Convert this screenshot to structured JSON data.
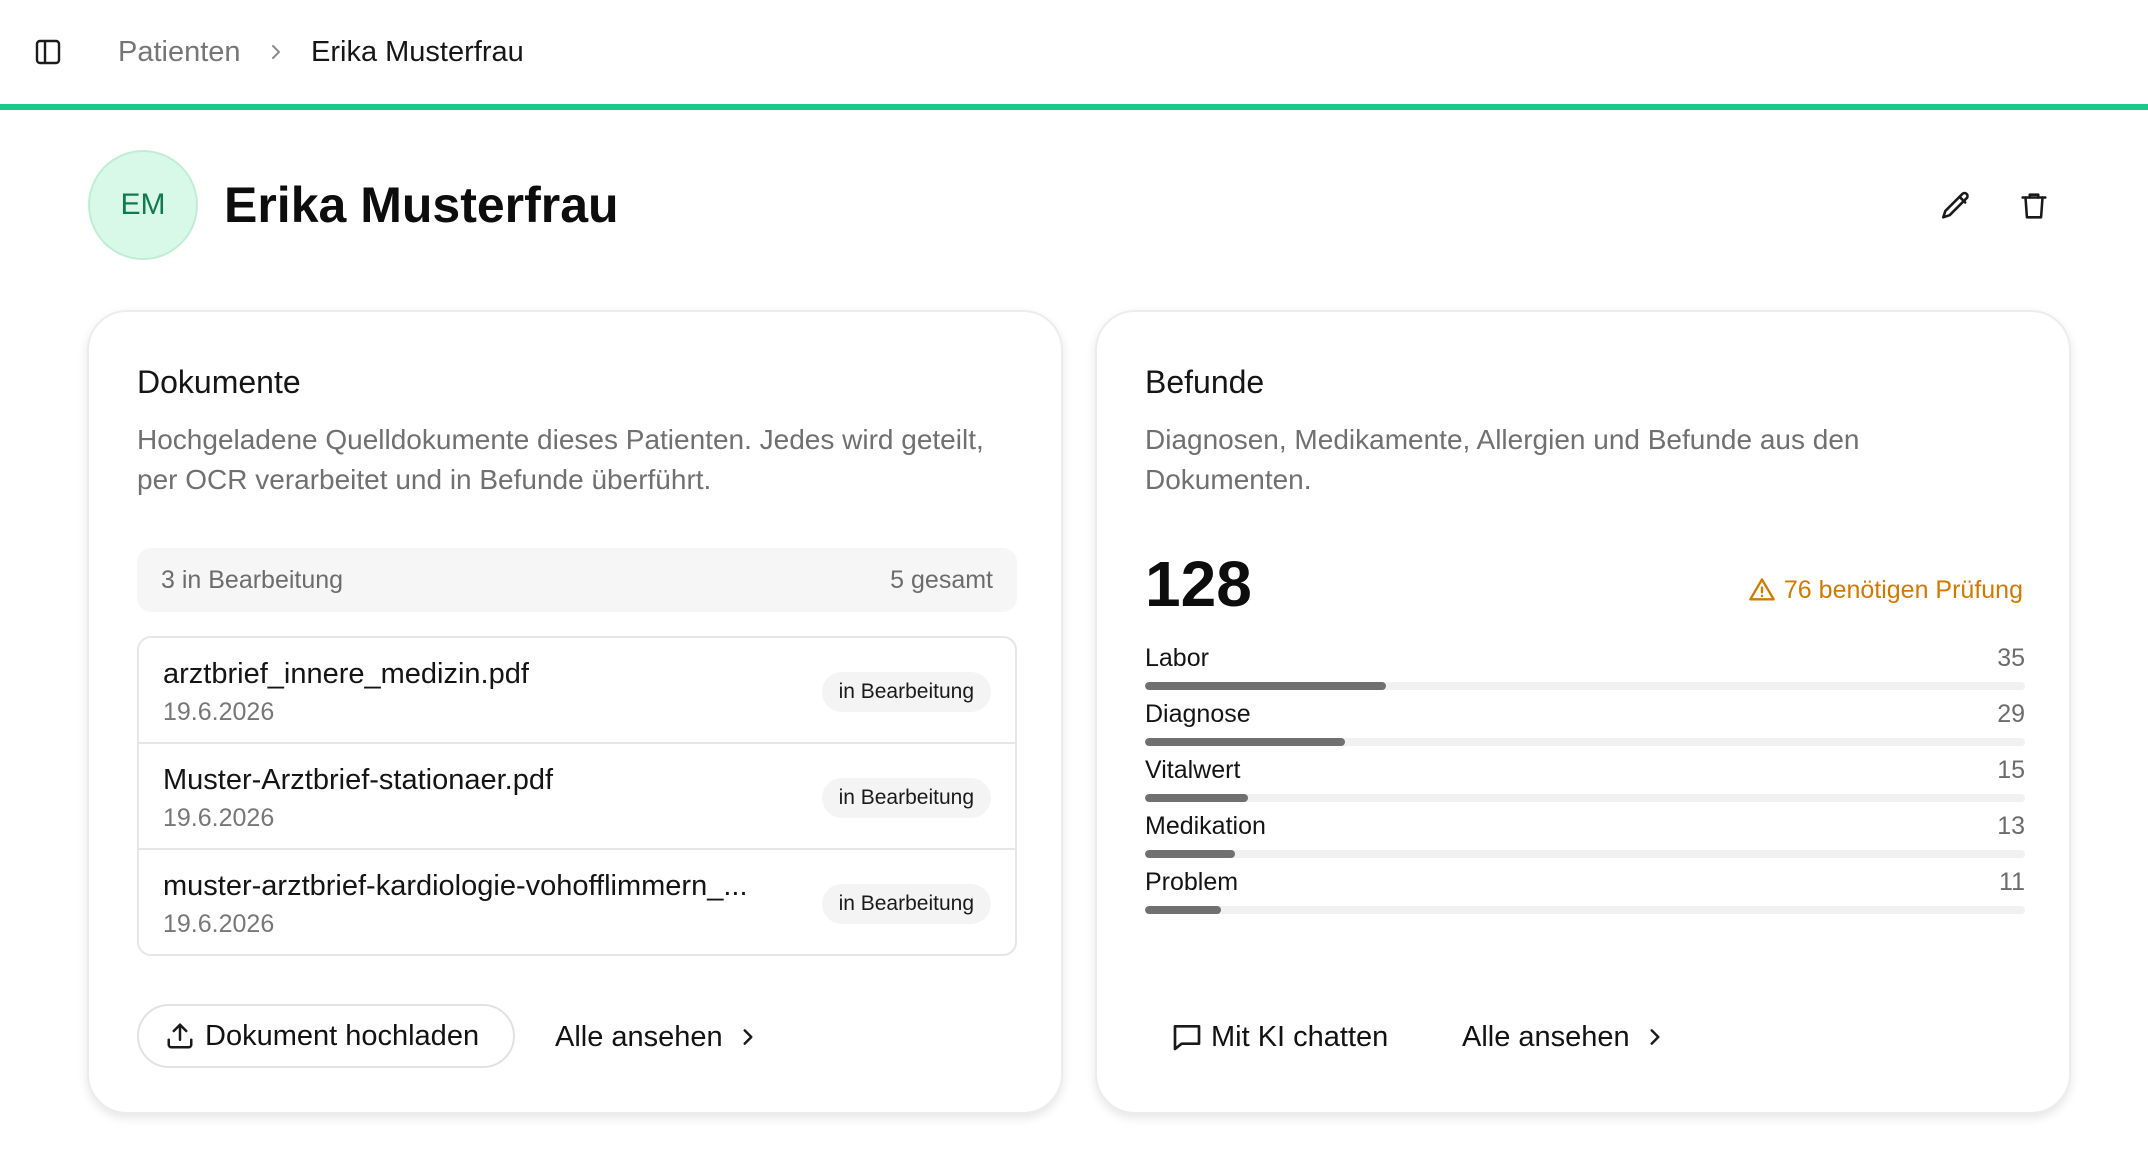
{
  "breadcrumb": {
    "parent": "Patienten",
    "current": "Erika Musterfrau"
  },
  "patient": {
    "initials": "EM",
    "name": "Erika Musterfrau"
  },
  "colors": {
    "accent": "#1cc98b",
    "avatar_bg": "#d8f8e8",
    "avatar_text": "#127a52",
    "warning": "#d27a00",
    "bar_fill": "#707070"
  },
  "icons": {
    "sidebar_toggle": "sidebar-toggle-icon",
    "breadcrumb_separator": "chevron-right-icon",
    "edit": "pencil-icon",
    "delete": "trash-icon",
    "upload": "upload-icon",
    "chat": "chat-bubble-icon",
    "warning": "warning-triangle-icon"
  },
  "documents": {
    "title": "Dokumente",
    "description": "Hochgeladene Quelldokumente dieses Patienten. Jedes wird geteilt, per OCR verarbeitet und in Befunde überführt.",
    "summary": {
      "in_progress": "3 in Bearbeitung",
      "total": "5 gesamt"
    },
    "items": [
      {
        "name": "arztbrief_innere_medizin.pdf",
        "date": "19.6.2026",
        "status": "in Bearbeitung"
      },
      {
        "name": "Muster-Arztbrief-stationaer.pdf",
        "date": "19.6.2026",
        "status": "in Bearbeitung"
      },
      {
        "name": "muster-arztbrief-kardiologie-vohofflimmern_...",
        "date": "19.6.2026",
        "status": "in Bearbeitung"
      }
    ],
    "upload_label": "Dokument hochladen",
    "view_all_label": "Alle ansehen"
  },
  "findings": {
    "title": "Befunde",
    "description": "Diagnosen, Medikamente, Allergien und Befunde aus den Dokumenten.",
    "total": "128",
    "review_notice": "76 benötigen Prüfung",
    "categories": [
      {
        "label": "Labor",
        "count": "35",
        "fraction": 0.274
      },
      {
        "label": "Diagnose",
        "count": "29",
        "fraction": 0.227
      },
      {
        "label": "Vitalwert",
        "count": "15",
        "fraction": 0.117
      },
      {
        "label": "Medikation",
        "count": "13",
        "fraction": 0.102
      },
      {
        "label": "Problem",
        "count": "11",
        "fraction": 0.086
      }
    ],
    "chat_label": "Mit KI chatten",
    "view_all_label": "Alle ansehen"
  }
}
